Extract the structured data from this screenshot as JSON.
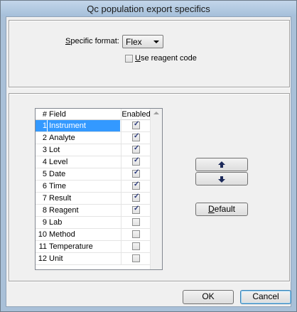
{
  "window": {
    "title": "Qc population export specifics"
  },
  "format": {
    "label_prefix": "S",
    "label_rest": "pecific format:",
    "value": "Flex"
  },
  "reagent": {
    "label_prefix": "U",
    "label_rest": "se reagent code",
    "checked": false
  },
  "grid": {
    "headers": {
      "num": "#",
      "field": "Field",
      "enabled": "Enabled"
    },
    "rows": [
      {
        "num": "1",
        "field": "Instrument",
        "enabled": true,
        "selected": true
      },
      {
        "num": "2",
        "field": "Analyte",
        "enabled": true
      },
      {
        "num": "3",
        "field": "Lot",
        "enabled": true
      },
      {
        "num": "4",
        "field": "Level",
        "enabled": true
      },
      {
        "num": "5",
        "field": "Date",
        "enabled": true
      },
      {
        "num": "6",
        "field": "Time",
        "enabled": true
      },
      {
        "num": "7",
        "field": "Result",
        "enabled": true
      },
      {
        "num": "8",
        "field": "Reagent",
        "enabled": true
      },
      {
        "num": "9",
        "field": "Lab",
        "enabled": false
      },
      {
        "num": "10",
        "field": "Method",
        "enabled": false
      },
      {
        "num": "11",
        "field": "Temperature",
        "enabled": false
      },
      {
        "num": "12",
        "field": "Unit",
        "enabled": false
      }
    ]
  },
  "buttons": {
    "default_prefix": "D",
    "default_rest": "efault",
    "ok": "OK",
    "cancel": "Cancel"
  },
  "icons": {
    "move_up": "arrow-up-icon",
    "move_down": "arrow-down-icon",
    "dropdown": "chevron-down-icon"
  }
}
